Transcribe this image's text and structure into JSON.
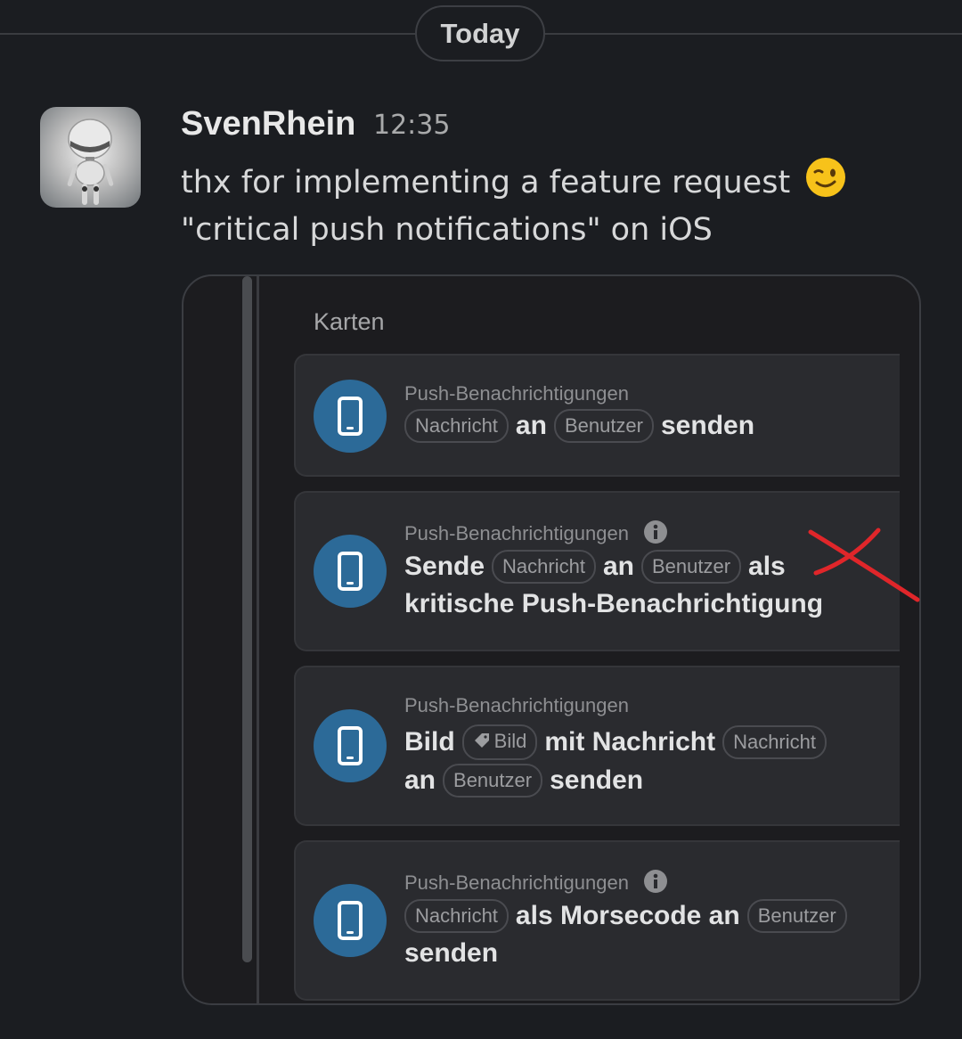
{
  "divider": {
    "label": "Today"
  },
  "message": {
    "author": "SvenRhein",
    "time": "12:35",
    "line1": "thx for implementing a feature request",
    "line2": "\"critical push notifications\" on iOS",
    "emoji": "wink-emoji"
  },
  "attachment": {
    "title": "Karten",
    "cards": [
      {
        "category": "Push-Benachrichtigungen",
        "row1": [
          {
            "t": "chip",
            "v": "Nachricht"
          },
          {
            "t": "word",
            "v": "an"
          },
          {
            "t": "chip",
            "v": "Benutzer"
          },
          {
            "t": "word",
            "v": "senden"
          }
        ]
      },
      {
        "category": "Push-Benachrichtigungen",
        "has_info": true,
        "row1": [
          {
            "t": "word",
            "v": "Sende"
          },
          {
            "t": "chip",
            "v": "Nachricht"
          },
          {
            "t": "word",
            "v": "an"
          },
          {
            "t": "chip",
            "v": "Benutzer"
          },
          {
            "t": "word",
            "v": "als"
          }
        ],
        "row2": [
          {
            "t": "word",
            "v": "kritische Push-Benachrichtigung"
          }
        ]
      },
      {
        "category": "Push-Benachrichtigungen",
        "row1": [
          {
            "t": "word",
            "v": "Bild"
          },
          {
            "t": "chip",
            "v": "Bild",
            "tag": true
          },
          {
            "t": "word",
            "v": "mit Nachricht"
          },
          {
            "t": "chip",
            "v": "Nachricht"
          }
        ],
        "row2": [
          {
            "t": "word",
            "v": "an"
          },
          {
            "t": "chip",
            "v": "Benutzer"
          },
          {
            "t": "word",
            "v": "senden"
          }
        ]
      },
      {
        "category": "Push-Benachrichtigungen",
        "has_info": true,
        "row1": [
          {
            "t": "chip",
            "v": "Nachricht"
          },
          {
            "t": "word",
            "v": "als Morsecode an"
          },
          {
            "t": "chip",
            "v": "Benutzer"
          }
        ],
        "row2": [
          {
            "t": "word",
            "v": "senden"
          }
        ]
      }
    ]
  },
  "colors": {
    "background": "#1b1d21",
    "card": "#2a2b2f",
    "icon_circle": "#2c6a98",
    "annotation": "#e0262a"
  }
}
